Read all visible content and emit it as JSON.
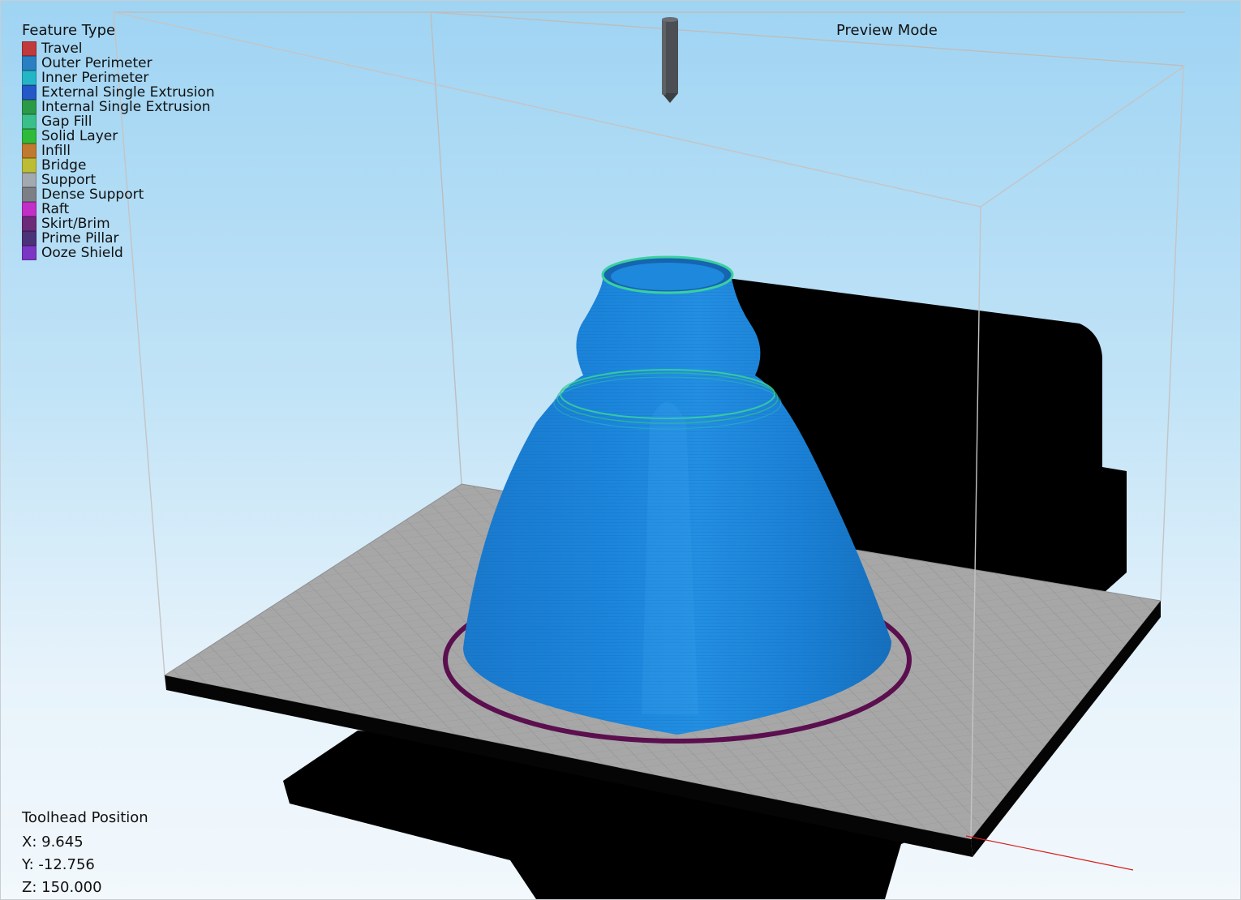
{
  "legend": {
    "title": "Feature Type",
    "items": [
      {
        "label": "Travel",
        "color": "#c0393b"
      },
      {
        "label": "Outer Perimeter",
        "color": "#2a7fc2"
      },
      {
        "label": "Inner Perimeter",
        "color": "#24b6c6"
      },
      {
        "label": "External Single Extrusion",
        "color": "#2457c8"
      },
      {
        "label": "Internal Single Extrusion",
        "color": "#2b9a48"
      },
      {
        "label": "Gap Fill",
        "color": "#3bbf8a"
      },
      {
        "label": "Solid Layer",
        "color": "#2fba3a"
      },
      {
        "label": "Infill",
        "color": "#c07a30"
      },
      {
        "label": "Bridge",
        "color": "#bcbc35"
      },
      {
        "label": "Support",
        "color": "#a3a9b0"
      },
      {
        "label": "Dense Support",
        "color": "#7c8086"
      },
      {
        "label": "Raft",
        "color": "#c12fc6"
      },
      {
        "label": "Skirt/Brim",
        "color": "#6b2b78"
      },
      {
        "label": "Prime Pillar",
        "color": "#4a3178"
      },
      {
        "label": "Ooze Shield",
        "color": "#7b36c4"
      }
    ]
  },
  "mode_label": "Preview Mode",
  "toolhead": {
    "title": "Toolhead Position",
    "x": "X: 9.645",
    "y": "Y: -12.756",
    "z": "Z: 150.000"
  },
  "colors": {
    "part": "#1a7fd4",
    "part_dark": "#0f5fa8",
    "skirt": "#5b0f4f",
    "bed_surface": "#a7a7a7",
    "bed_grid": "#8f8f8f",
    "machine": "#000000",
    "build_volume": "#bfbfbf",
    "nozzle": "#4b4e52",
    "axis_x": "#d42020"
  }
}
